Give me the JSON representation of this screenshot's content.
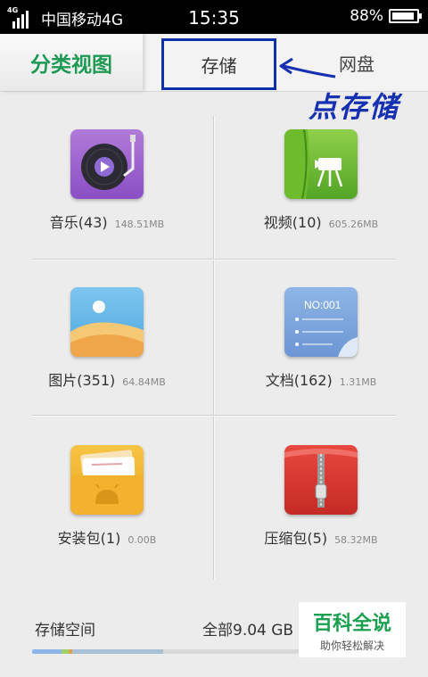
{
  "status_bar": {
    "network": "中国移动4G",
    "signal_tag": "4G",
    "time": "15:35",
    "battery": "88%"
  },
  "tabs": {
    "category": "分类视图",
    "storage": "存储",
    "netdisk": "网盘"
  },
  "annotation": {
    "text": "点存储",
    "color": "#1530b0"
  },
  "categories": [
    {
      "label": "音乐(43)",
      "size": "148.51MB",
      "icon": "music-icon"
    },
    {
      "label": "视频(10)",
      "size": "605.26MB",
      "icon": "video-icon"
    },
    {
      "label": "图片(351)",
      "size": "64.84MB",
      "icon": "picture-icon"
    },
    {
      "label": "文档(162)",
      "size": "1.31MB",
      "icon": "document-icon",
      "doc_text": "NO:001"
    },
    {
      "label": "安装包(1)",
      "size": "0.00B",
      "icon": "apk-icon"
    },
    {
      "label": "压缩包(5)",
      "size": "58.32MB",
      "icon": "archive-icon"
    }
  ],
  "storage": {
    "title": "存储空间",
    "total": "全部9.04 GB",
    "usage_fractions": [
      0.08,
      0.02,
      0.01,
      0.25
    ],
    "usage_colors": [
      "#8ab4ea",
      "#9ed36a",
      "#e2a04a",
      "#a7c2d6"
    ]
  },
  "watermark": {
    "line1": "百科全说",
    "line2": "助你轻松解决"
  },
  "colors": {
    "accent_green": "#1f9a54",
    "highlight_box": "#0d2fa8"
  }
}
